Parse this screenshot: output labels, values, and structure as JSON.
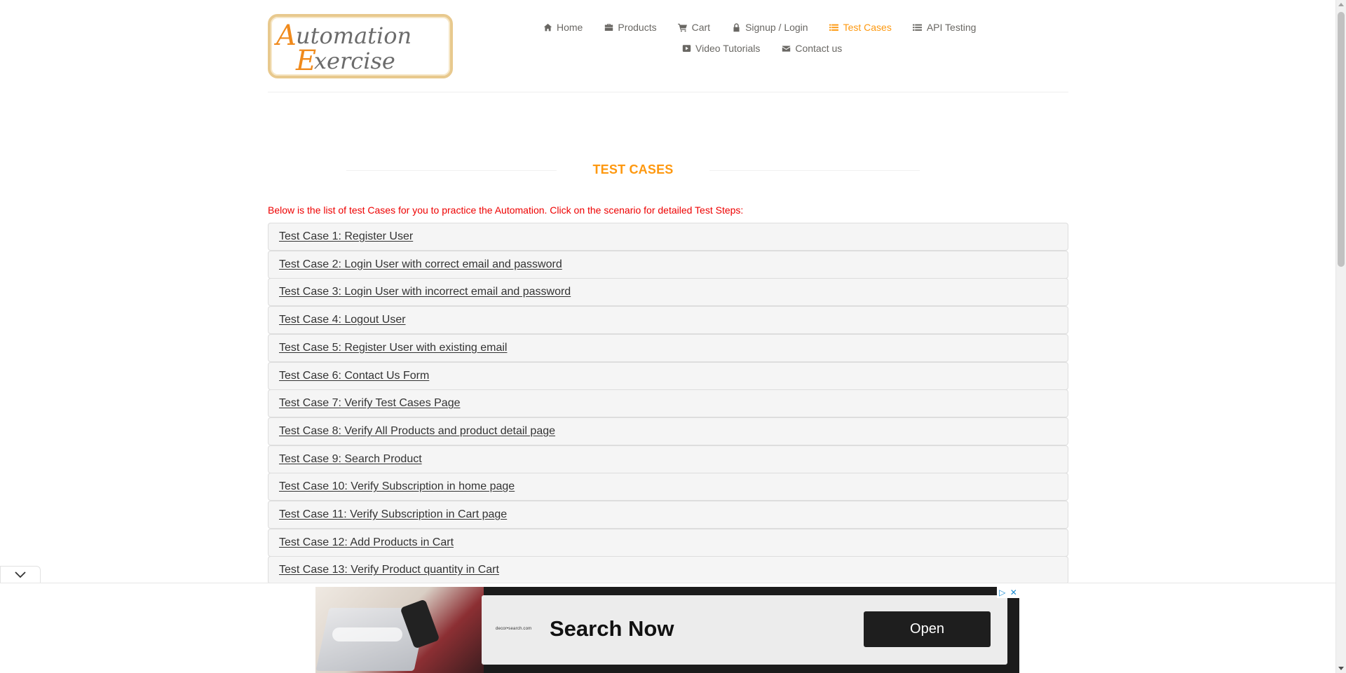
{
  "logo": {
    "line1": "Automation",
    "line2": "Exercise"
  },
  "nav": {
    "row1": [
      {
        "label": "Home",
        "icon": "home-icon"
      },
      {
        "label": "Products",
        "icon": "briefcase-icon"
      },
      {
        "label": "Cart",
        "icon": "cart-icon"
      },
      {
        "label": "Signup / Login",
        "icon": "lock-icon"
      },
      {
        "label": "Test Cases",
        "icon": "list-icon",
        "active": true
      },
      {
        "label": "API Testing",
        "icon": "list-icon"
      }
    ],
    "row2": [
      {
        "label": "Video Tutorials",
        "icon": "youtube-icon"
      },
      {
        "label": "Contact us",
        "icon": "envelope-icon"
      }
    ]
  },
  "page": {
    "title": "TEST CASES",
    "intro": "Below is the list of test Cases for you to practice the Automation. Click on the scenario for detailed Test Steps:"
  },
  "test_cases": [
    "Test Case 1: Register User",
    "Test Case 2: Login User with correct email and password",
    "Test Case 3: Login User with incorrect email and password",
    "Test Case 4: Logout User",
    "Test Case 5: Register User with existing email",
    "Test Case 6: Contact Us Form",
    "Test Case 7: Verify Test Cases Page",
    "Test Case 8: Verify All Products and product detail page",
    "Test Case 9: Search Product",
    "Test Case 10: Verify Subscription in home page",
    "Test Case 11: Verify Subscription in Cart page",
    "Test Case 12: Add Products in Cart",
    "Test Case 13: Verify Product quantity in Cart"
  ],
  "ad": {
    "brand": "decor•search.com",
    "headline": "Search Now",
    "cta": "Open",
    "choices_icon": "▷",
    "close_icon": "✕"
  },
  "colors": {
    "accent": "#fe980f",
    "intro_text": "#ee0000",
    "list_bg": "#f5f5f5"
  }
}
